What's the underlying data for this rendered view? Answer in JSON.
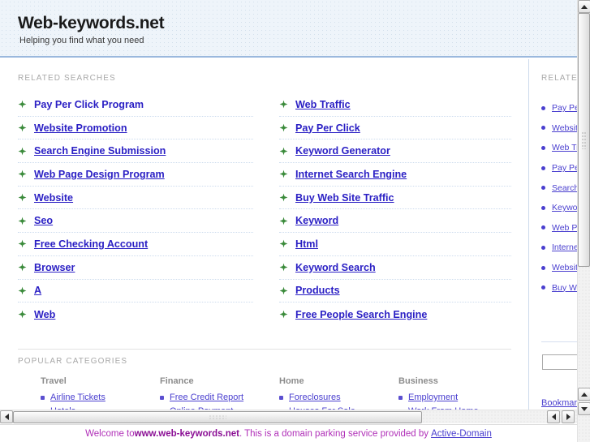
{
  "header": {
    "title": "Web-keywords.net",
    "tagline": "Helping you find what you need"
  },
  "main": {
    "related_label": "RELATED SEARCHES",
    "links_left": [
      "Pay Per Click Program",
      "Website Promotion",
      "Search Engine Submission",
      "Web Page Design Program",
      "Website",
      "Seo",
      "Free Checking Account",
      "Browser",
      "A",
      "Web"
    ],
    "links_right": [
      "Web Traffic",
      "Pay Per Click",
      "Keyword Generator",
      "Internet Search Engine",
      "Buy Web Site Traffic",
      "Keyword",
      "Html",
      "Keyword Search",
      "Products",
      "Free People Search Engine"
    ],
    "categories_label": "POPULAR CATEGORIES",
    "categories": [
      {
        "title": "Travel",
        "items": [
          "Airline Tickets",
          "Hotels"
        ]
      },
      {
        "title": "Finance",
        "items": [
          "Free Credit Report",
          "Online Payment"
        ]
      },
      {
        "title": "Home",
        "items": [
          "Foreclosures",
          "Houses For Sale"
        ]
      },
      {
        "title": "Business",
        "items": [
          "Employment",
          "Work From Home"
        ]
      }
    ]
  },
  "sidebar": {
    "label": "RELATED SEARCHES",
    "links": [
      "Pay Per Click Program",
      "Website Promotion",
      "Web Traffic",
      "Pay Per Click",
      "Search Engine Submission",
      "Keyword Generator",
      "Web Page Design Program",
      "Internet Search Engine",
      "Website",
      "Buy Web Site Traffic"
    ],
    "search_value": "",
    "search_placeholder": "",
    "bookmark_label": "Bookmark"
  },
  "status": {
    "prefix": "Welcome to ",
    "domain": "www.web-keywords.net",
    "middle": ". This is a domain parking service provided by ",
    "link": "Active-Domain"
  },
  "colors": {
    "link": "#2a1fc4",
    "bullet_green": "#3a8a3a",
    "header_bg": "#eef4fa",
    "status_text": "#b02fb8"
  }
}
